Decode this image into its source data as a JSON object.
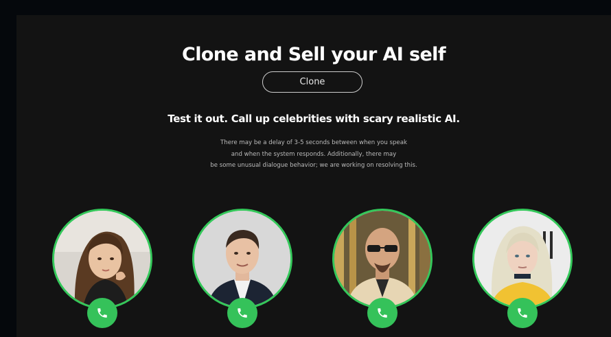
{
  "header": {
    "title": "Clone and Sell your AI self",
    "clone_button_label": "Clone"
  },
  "intro": {
    "heading": "Test it out. Call up celebrities with scary realistic AI.",
    "note_lines": [
      "There may be a delay of 3-5 seconds between when you speak",
      "and when the system responds. Additionally, there may",
      "be some unusual dialogue behavior; we are working on resolving this."
    ]
  },
  "celebrities": [
    {
      "portrait": "woman-with-long-brown-hair-portrait",
      "call_icon": "phone-icon"
    },
    {
      "portrait": "man-in-dark-suit-portrait",
      "call_icon": "phone-icon"
    },
    {
      "portrait": "bald-man-with-sunglasses-portrait",
      "call_icon": "phone-icon"
    },
    {
      "portrait": "woman-with-platinum-hair-portrait",
      "call_icon": "phone-icon"
    }
  ],
  "colors": {
    "page_background": "#05080c",
    "panel_background": "#131313",
    "accent_green": "#35c25a",
    "ring_green": "#34c85a",
    "text_primary": "#ffffff",
    "text_muted": "#bcbcbc"
  }
}
